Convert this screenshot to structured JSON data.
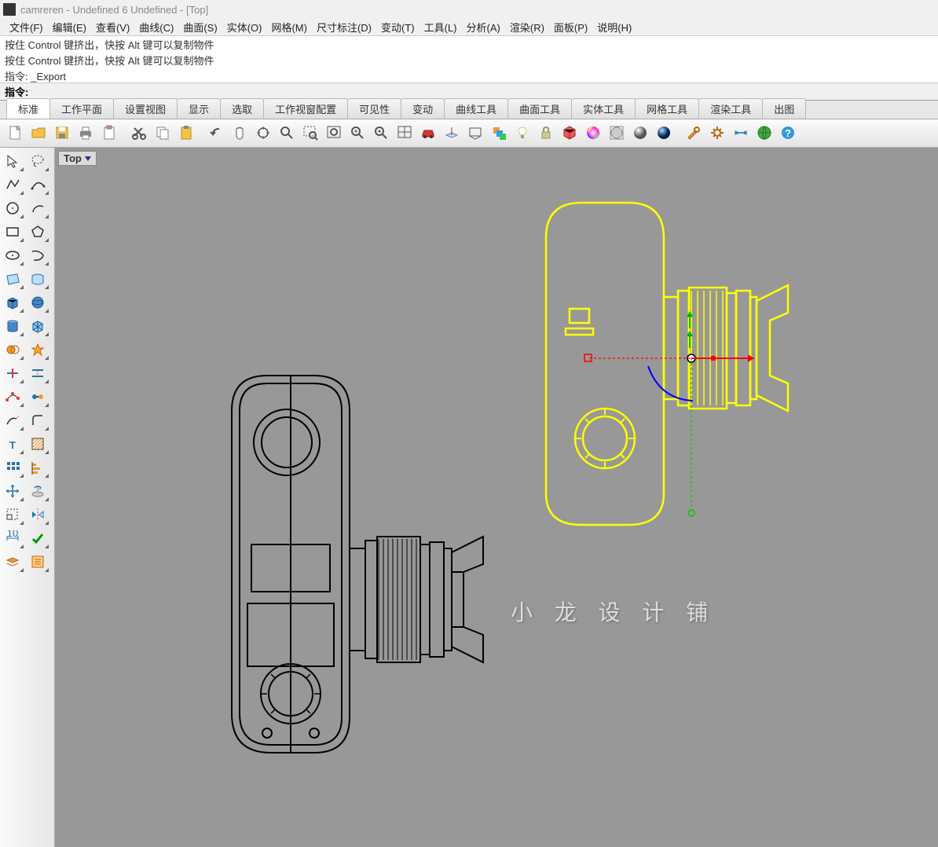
{
  "title": "camreren - Undefined 6 Undefined - [Top]",
  "menus": {
    "file": "文件(F)",
    "edit": "编辑(E)",
    "view": "查看(V)",
    "curve": "曲线(C)",
    "surface": "曲面(S)",
    "solid": "实体(O)",
    "mesh": "网格(M)",
    "dim": "尺寸标注(D)",
    "transform": "变动(T)",
    "tools": "工具(L)",
    "analyze": "分析(A)",
    "render": "渲染(R)",
    "panel": "面板(P)",
    "help": "说明(H)"
  },
  "history": {
    "line1": "按住 Control 键挤出，快按 Alt 键可以复制物件",
    "line2": "按住 Control 键挤出，快按 Alt 键可以复制物件",
    "line3": "指令: _Export"
  },
  "command": {
    "prompt": "指令:",
    "value": ""
  },
  "tabs": {
    "t1": "标准",
    "t2": "工作平面",
    "t3": "设置视图",
    "t4": "显示",
    "t5": "选取",
    "t6": "工作视窗配置",
    "t7": "可见性",
    "t8": "变动",
    "t9": "曲线工具",
    "t10": "曲面工具",
    "t11": "实体工具",
    "t12": "网格工具",
    "t13": "渲染工具",
    "t14": "出图"
  },
  "toolbar": {
    "new": "new-file",
    "open": "open-file",
    "save": "save-file",
    "print": "print",
    "clipboard": "clipboard",
    "cut": "cut",
    "copy": "copy",
    "paste": "paste",
    "undo": "undo",
    "pan": "pan",
    "rotate": "rotate-view",
    "zoom": "zoom",
    "zoomwin": "zoom-window",
    "zoomext": "zoom-extents",
    "zoomsel": "zoom-selected",
    "zoomtarget": "zoom-target",
    "4view": "four-views",
    "car": "set-view",
    "cplane": "cplane",
    "named": "named-views",
    "layers": "layer-colors",
    "light": "light",
    "lock": "lock",
    "materials": "materials",
    "color": "color-wheel",
    "render": "render-settings",
    "shade1": "render-shade",
    "shade2": "shaded-view",
    "options": "options",
    "gear": "properties",
    "dim": "dimension",
    "globe": "web",
    "help": "help"
  },
  "viewport": {
    "label": "Top"
  },
  "watermark": "小 龙 设 计 铺",
  "chart_data": {
    "type": "cad-drawing",
    "description": "Rhino viewport showing two top-view wireframe drawings of a compact camera with lens",
    "objects": [
      {
        "name": "camera-wireframe-black",
        "color": "#000000",
        "selected": false,
        "position": "left",
        "approx_bbox": [
          200,
          280,
          610,
          780
        ]
      },
      {
        "name": "camera-wireframe-yellow",
        "color": "#ffff00",
        "selected": true,
        "position": "right",
        "approx_bbox": [
          600,
          60,
          1010,
          490
        ]
      }
    ],
    "gumball": {
      "visible": true,
      "origin": "on selected yellow object",
      "axes": {
        "x": "#ff0000",
        "y": "#00cc00",
        "z": "#0000ff"
      }
    }
  }
}
